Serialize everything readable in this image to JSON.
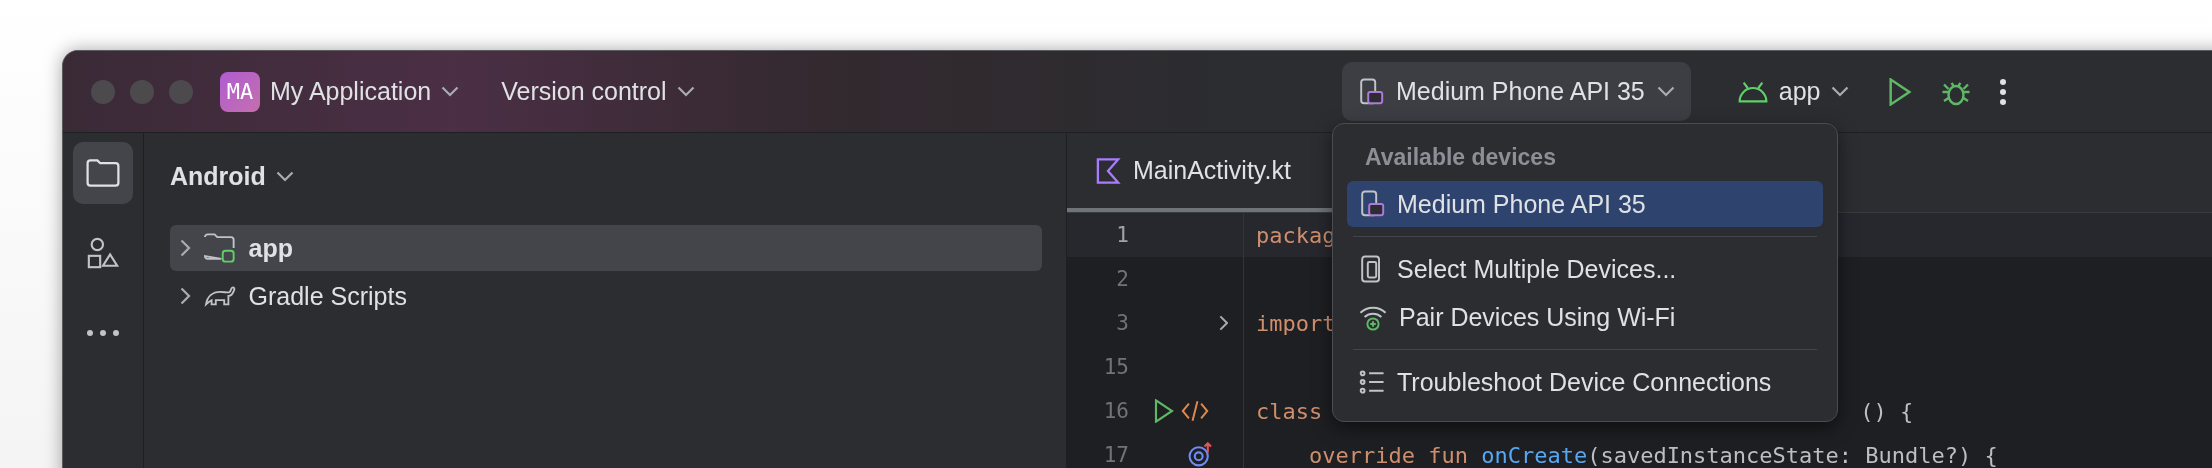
{
  "title_bar": {
    "project_badge": "MA",
    "project": "My Application",
    "vcs": "Version control",
    "device_selector": "Medium Phone API 35",
    "run_config": "app"
  },
  "tool_strip": [
    {
      "kind": "folder",
      "selected": true
    },
    {
      "kind": "shapes",
      "selected": false
    },
    {
      "kind": "more",
      "selected": false
    }
  ],
  "project_panel": {
    "view": "Android",
    "tree": [
      {
        "label": "app",
        "kind": "module",
        "selected": true,
        "expanded": false
      },
      {
        "label": "Gradle Scripts",
        "kind": "gradle",
        "selected": false,
        "expanded": false
      }
    ]
  },
  "editor": {
    "tabs": [
      {
        "label": "MainActivity.kt",
        "selected": true
      }
    ],
    "lines": [
      {
        "number": "1",
        "current": true,
        "segments": [
          {
            "kind": "keyword",
            "text": "packag"
          }
        ]
      },
      {
        "number": "2",
        "current": false
      },
      {
        "number": "3",
        "current": false,
        "folded": true,
        "segments": [
          {
            "kind": "keyword",
            "text": "import"
          }
        ]
      },
      {
        "number": "15",
        "current": false
      },
      {
        "number": "16",
        "current": false,
        "gutter": [
          {
            "kind": "run"
          },
          {
            "kind": "code"
          }
        ],
        "segments": [
          {
            "kind": "keyword",
            "text": "class"
          },
          {
            "kind": "plain",
            "text": "() {",
            "gap": true
          }
        ]
      },
      {
        "number": "17",
        "current": false,
        "indented": true,
        "gutter": [
          {
            "kind": "override"
          }
        ],
        "segments": [
          {
            "kind": "keyword",
            "text": "override fun "
          },
          {
            "kind": "function",
            "text": "onCreate"
          },
          {
            "kind": "plain",
            "text": "(savedInstanceState: Bundle?) {"
          }
        ]
      }
    ]
  },
  "device_menu": {
    "header": "Available devices",
    "groups": [
      {
        "items": [
          {
            "kind": "device",
            "label": "Medium Phone API 35",
            "selected": true
          }
        ]
      },
      {
        "items": [
          {
            "kind": "multiple",
            "label": "Select Multiple Devices...",
            "selected": false
          },
          {
            "kind": "wifi",
            "label": "Pair Devices Using Wi-Fi",
            "selected": false
          }
        ]
      },
      {
        "items": [
          {
            "kind": "troubleshoot",
            "label": "Troubleshoot Device Connections",
            "selected": false
          }
        ]
      }
    ]
  }
}
